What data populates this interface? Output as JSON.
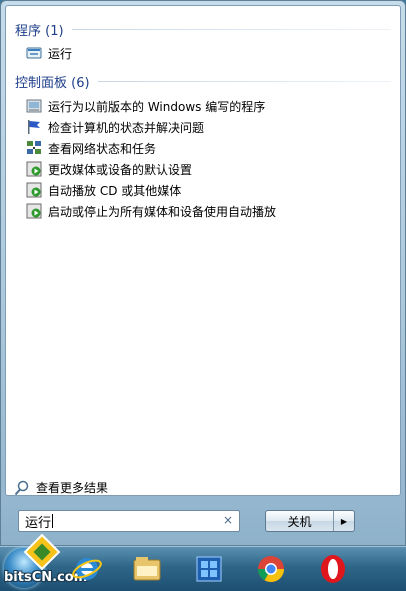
{
  "programs": {
    "header": "程序 (1)",
    "items": [
      {
        "label": "运行",
        "icon": "run-icon"
      }
    ]
  },
  "control_panel": {
    "header": "控制面板 (6)",
    "items": [
      {
        "label": "运行为以前版本的 Windows 编写的程序",
        "icon": "compatibility-icon"
      },
      {
        "label": "检查计算机的状态并解决问题",
        "icon": "action-center-flag-icon"
      },
      {
        "label": "查看网络状态和任务",
        "icon": "network-icon"
      },
      {
        "label": "更改媒体或设备的默认设置",
        "icon": "autoplay-icon"
      },
      {
        "label": "自动播放 CD 或其他媒体",
        "icon": "autoplay-icon"
      },
      {
        "label": "启动或停止为所有媒体和设备使用自动播放",
        "icon": "autoplay-icon"
      }
    ]
  },
  "see_more": "查看更多结果",
  "search": {
    "value": "运行",
    "clear_glyph": "×"
  },
  "shutdown": {
    "label": "关机",
    "arrow": "▶"
  },
  "watermark": {
    "text": "bitsCN.com"
  },
  "taskbar": {
    "pinned": [
      "internet-explorer-icon",
      "file-explorer-icon",
      "windows-media-center-icon",
      "chrome-icon",
      "opera-icon"
    ]
  }
}
